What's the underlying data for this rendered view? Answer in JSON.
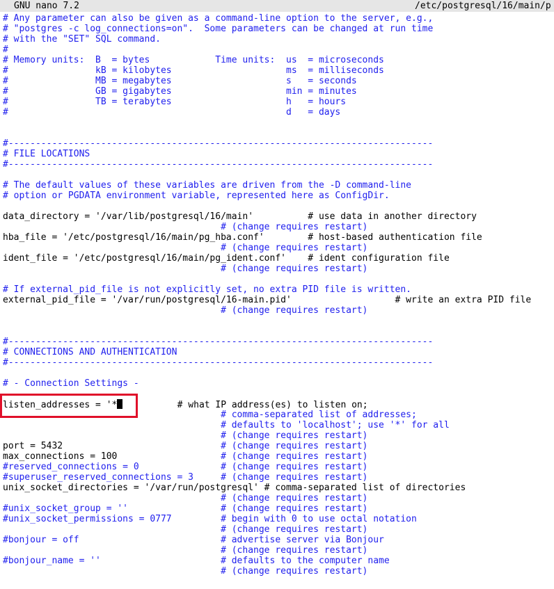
{
  "window": {
    "app_title": "GNU nano 7.2",
    "file_path": "/etc/postgresql/16/main/p"
  },
  "colors": {
    "comment": "#2020ee",
    "text": "#000000",
    "titlebar_bg": "#e6e6e6",
    "highlight_box": "#e0102a"
  },
  "editor": {
    "lines": [
      {
        "comment": "# Any parameter can also be given as a command-line option to the server, e.g.,"
      },
      {
        "comment": "# \"postgres -c log_connections=on\".  Some parameters can be changed at run time"
      },
      {
        "comment": "# with the \"SET\" SQL command."
      },
      {
        "comment": "#"
      },
      {
        "comment": "# Memory units:  B  = bytes            Time units:  us  = microseconds"
      },
      {
        "comment": "#                kB = kilobytes                     ms  = milliseconds"
      },
      {
        "comment": "#                MB = megabytes                     s   = seconds"
      },
      {
        "comment": "#                GB = gigabytes                     min = minutes"
      },
      {
        "comment": "#                TB = terabytes                     h   = hours"
      },
      {
        "comment": "#                                                   d   = days"
      },
      {},
      {},
      {
        "comment": "#------------------------------------------------------------------------------"
      },
      {
        "comment": "# FILE LOCATIONS"
      },
      {
        "comment": "#------------------------------------------------------------------------------"
      },
      {},
      {
        "comment": "# The default values of these variables are driven from the -D command-line"
      },
      {
        "comment": "# option or PGDATA environment variable, represented here as ConfigDir."
      },
      {},
      {
        "code": "data_directory = '/var/lib/postgresql/16/main'          # use data in another directory"
      },
      {
        "comment": "                                        # (change requires restart)"
      },
      {
        "code": "hba_file = '/etc/postgresql/16/main/pg_hba.conf'        # host-based authentication file"
      },
      {
        "comment": "                                        # (change requires restart)"
      },
      {
        "code": "ident_file = '/etc/postgresql/16/main/pg_ident.conf'    # ident configuration file"
      },
      {
        "comment": "                                        # (change requires restart)"
      },
      {},
      {
        "comment": "# If external_pid_file is not explicitly set, no extra PID file is written."
      },
      {
        "code": "external_pid_file = '/var/run/postgresql/16-main.pid'                   # write an extra PID file"
      },
      {
        "comment": "                                        # (change requires restart)"
      },
      {},
      {},
      {
        "comment": "#------------------------------------------------------------------------------"
      },
      {
        "comment": "# CONNECTIONS AND AUTHENTICATION"
      },
      {
        "comment": "#------------------------------------------------------------------------------"
      },
      {},
      {
        "comment": "# - Connection Settings -"
      },
      {},
      {
        "code": "listen_addresses = '*",
        "cursor": true,
        "code_after": "          # what IP address(es) to listen on;"
      },
      {
        "comment": "                                        # comma-separated list of addresses;"
      },
      {
        "comment": "                                        # defaults to 'localhost'; use '*' for all"
      },
      {
        "comment": "                                        # (change requires restart)"
      },
      {
        "code": "port = 5432",
        "comment": "                             # (change requires restart)"
      },
      {
        "code": "max_connections = 100",
        "comment": "                   # (change requires restart)"
      },
      {
        "comment": "#reserved_connections = 0               # (change requires restart)"
      },
      {
        "comment": "#superuser_reserved_connections = 3     # (change requires restart)"
      },
      {
        "code": "unix_socket_directories = '/var/run/postgresql' # comma-separated list of directories"
      },
      {
        "comment": "                                        # (change requires restart)"
      },
      {
        "comment": "#unix_socket_group = ''                 # (change requires restart)"
      },
      {
        "comment": "#unix_socket_permissions = 0777         # begin with 0 to use octal notation"
      },
      {
        "comment": "                                        # (change requires restart)"
      },
      {
        "comment": "#bonjour = off                          # advertise server via Bonjour"
      },
      {
        "comment": "                                        # (change requires restart)"
      },
      {
        "comment": "#bonjour_name = ''                      # defaults to the computer name"
      },
      {
        "comment": "                                        # (change requires restart)"
      }
    ]
  }
}
